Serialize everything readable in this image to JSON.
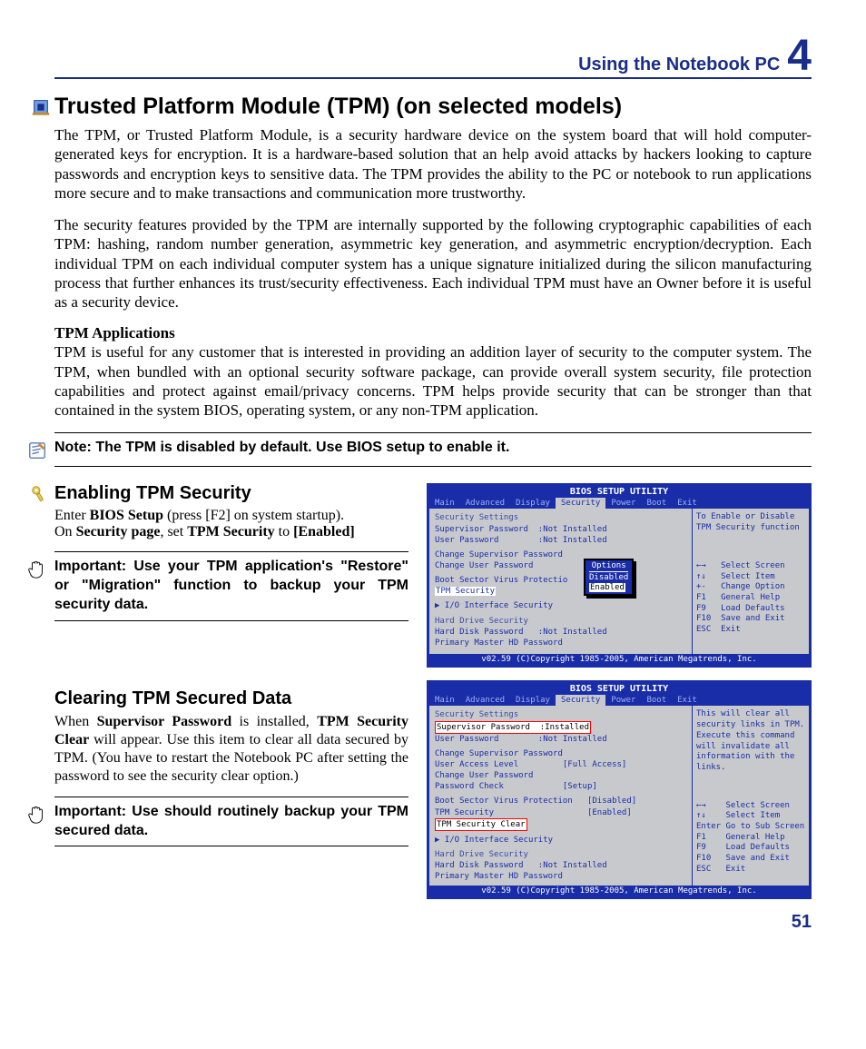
{
  "header": {
    "title": "Using the Notebook PC",
    "chapter": "4"
  },
  "h1": "Trusted Platform Module (TPM) (on selected models)",
  "para1": "The TPM, or Trusted Platform Module, is a security hardware device on the system board that will hold computer-generated keys for encryption. It is a hardware-based solution that an help avoid attacks by hackers looking to capture passwords and encryption keys to sensitive data. The TPM provides the ability to the PC or notebook to run applications more secure and to make transactions and communication more trustworthy.",
  "para2": "The security features provided by the TPM are internally supported by the following cryptographic capabilities of each TPM: hashing, random number generation, asymmetric key generation, and asymmetric encryption/decryption. Each individual TPM on each individual computer system has a unique signature initialized during the silicon manufacturing process that further enhances its trust/security effectiveness. Each individual TPM must have an Owner before it is useful as a security device.",
  "sub_apps": "TPM Applications",
  "para3": "TPM is useful for any customer that is interested in providing an addition layer of security to the computer system. The TPM, when bundled with an optional security software package, can provide overall system security, file protection capabilities and protect against email/privacy concerns. TPM helps provide security that can be stronger than that contained in the system BIOS, operating system, or any non-TPM application.",
  "note1": "Note: The TPM is disabled by default. Use BIOS setup to enable it.",
  "sec_enable": {
    "title": "Enabling TPM Security",
    "line1a": "Enter ",
    "line1b": "BIOS Setup",
    "line1c": " (press [F2] on system startup).",
    "line2a": "On ",
    "line2b": "Security page",
    "line2c": ", set ",
    "line2d": "TPM Security",
    "line2e": " to ",
    "line2f": "[Enabled]",
    "important": "Important: Use your TPM application's \"Restore\" or \"Migration\" function to backup your TPM security data."
  },
  "sec_clear": {
    "title": "Clearing TPM Secured Data",
    "body_a": "When ",
    "body_b": "Supervisor Password",
    "body_c": " is installed, ",
    "body_d": "TPM Security Clear",
    "body_e": " will appear. Use this item to clear all data secured by TPM. (You have to restart the Notebook PC after setting the password to see the security clear option.)",
    "important": "Important: Use should routinely backup your TPM secured data."
  },
  "bios_common": {
    "title": "BIOS SETUP UTILITY",
    "tabs": [
      "Main",
      "Advanced",
      "Display",
      "Security",
      "Power",
      "Boot",
      "Exit"
    ],
    "footer": "v02.59 (C)Copyright 1985-2005, American Megatrends, Inc.",
    "keys": [
      "←→   Select Screen",
      "↑↓   Select Item",
      "+-   Change Option",
      "F1   General Help",
      "F9   Load Defaults",
      "F10  Save and Exit",
      "ESC  Exit"
    ],
    "keys2": [
      "←→    Select Screen",
      "↑↓    Select Item",
      "Enter Go to Sub Screen",
      "F1    General Help",
      "F9    Load Defaults",
      "F10   Save and Exit",
      "ESC   Exit"
    ]
  },
  "bios1": {
    "help": "To Enable or Disable TPM Security function",
    "heading": "Security Settings",
    "l1": "Supervisor Password  :Not Installed",
    "l2": "User Password        :Not Installed",
    "l3": "Change Supervisor Password",
    "l4": "Change User Password",
    "l5": "Boot Sector Virus Protectio",
    "l6": "TPM Security",
    "l7": "▶ I/O Interface Security",
    "l8": "Hard Drive Security",
    "l9": "Hard Disk Password   :Not Installed",
    "l10": "Primary Master HD Password",
    "popup_title": "Options",
    "popup_opt1": "Disabled",
    "popup_opt2": "Enabled"
  },
  "bios2": {
    "help": "This will clear all security links in TPM. Execute this command will invalidate all information with the links.",
    "heading": "Security Settings",
    "l1a": "Supervisor Password  :",
    "l1b": "Installed",
    "l2": "User Password        :Not Installed",
    "l3": "Change Supervisor Password",
    "l4": "User Access Level         [Full Access]",
    "l5": "Change User Password",
    "l6": "Password Check            [Setup]",
    "l7": "Boot Sector Virus Protection   [Disabled]",
    "l8": "TPM Security                   [Enabled]",
    "l9": "TPM Security Clear",
    "l10": "▶ I/O Interface Security",
    "l11": "Hard Drive Security",
    "l12": "Hard Disk Password   :Not Installed",
    "l13": "Primary Master HD Password"
  },
  "page_number": "51"
}
